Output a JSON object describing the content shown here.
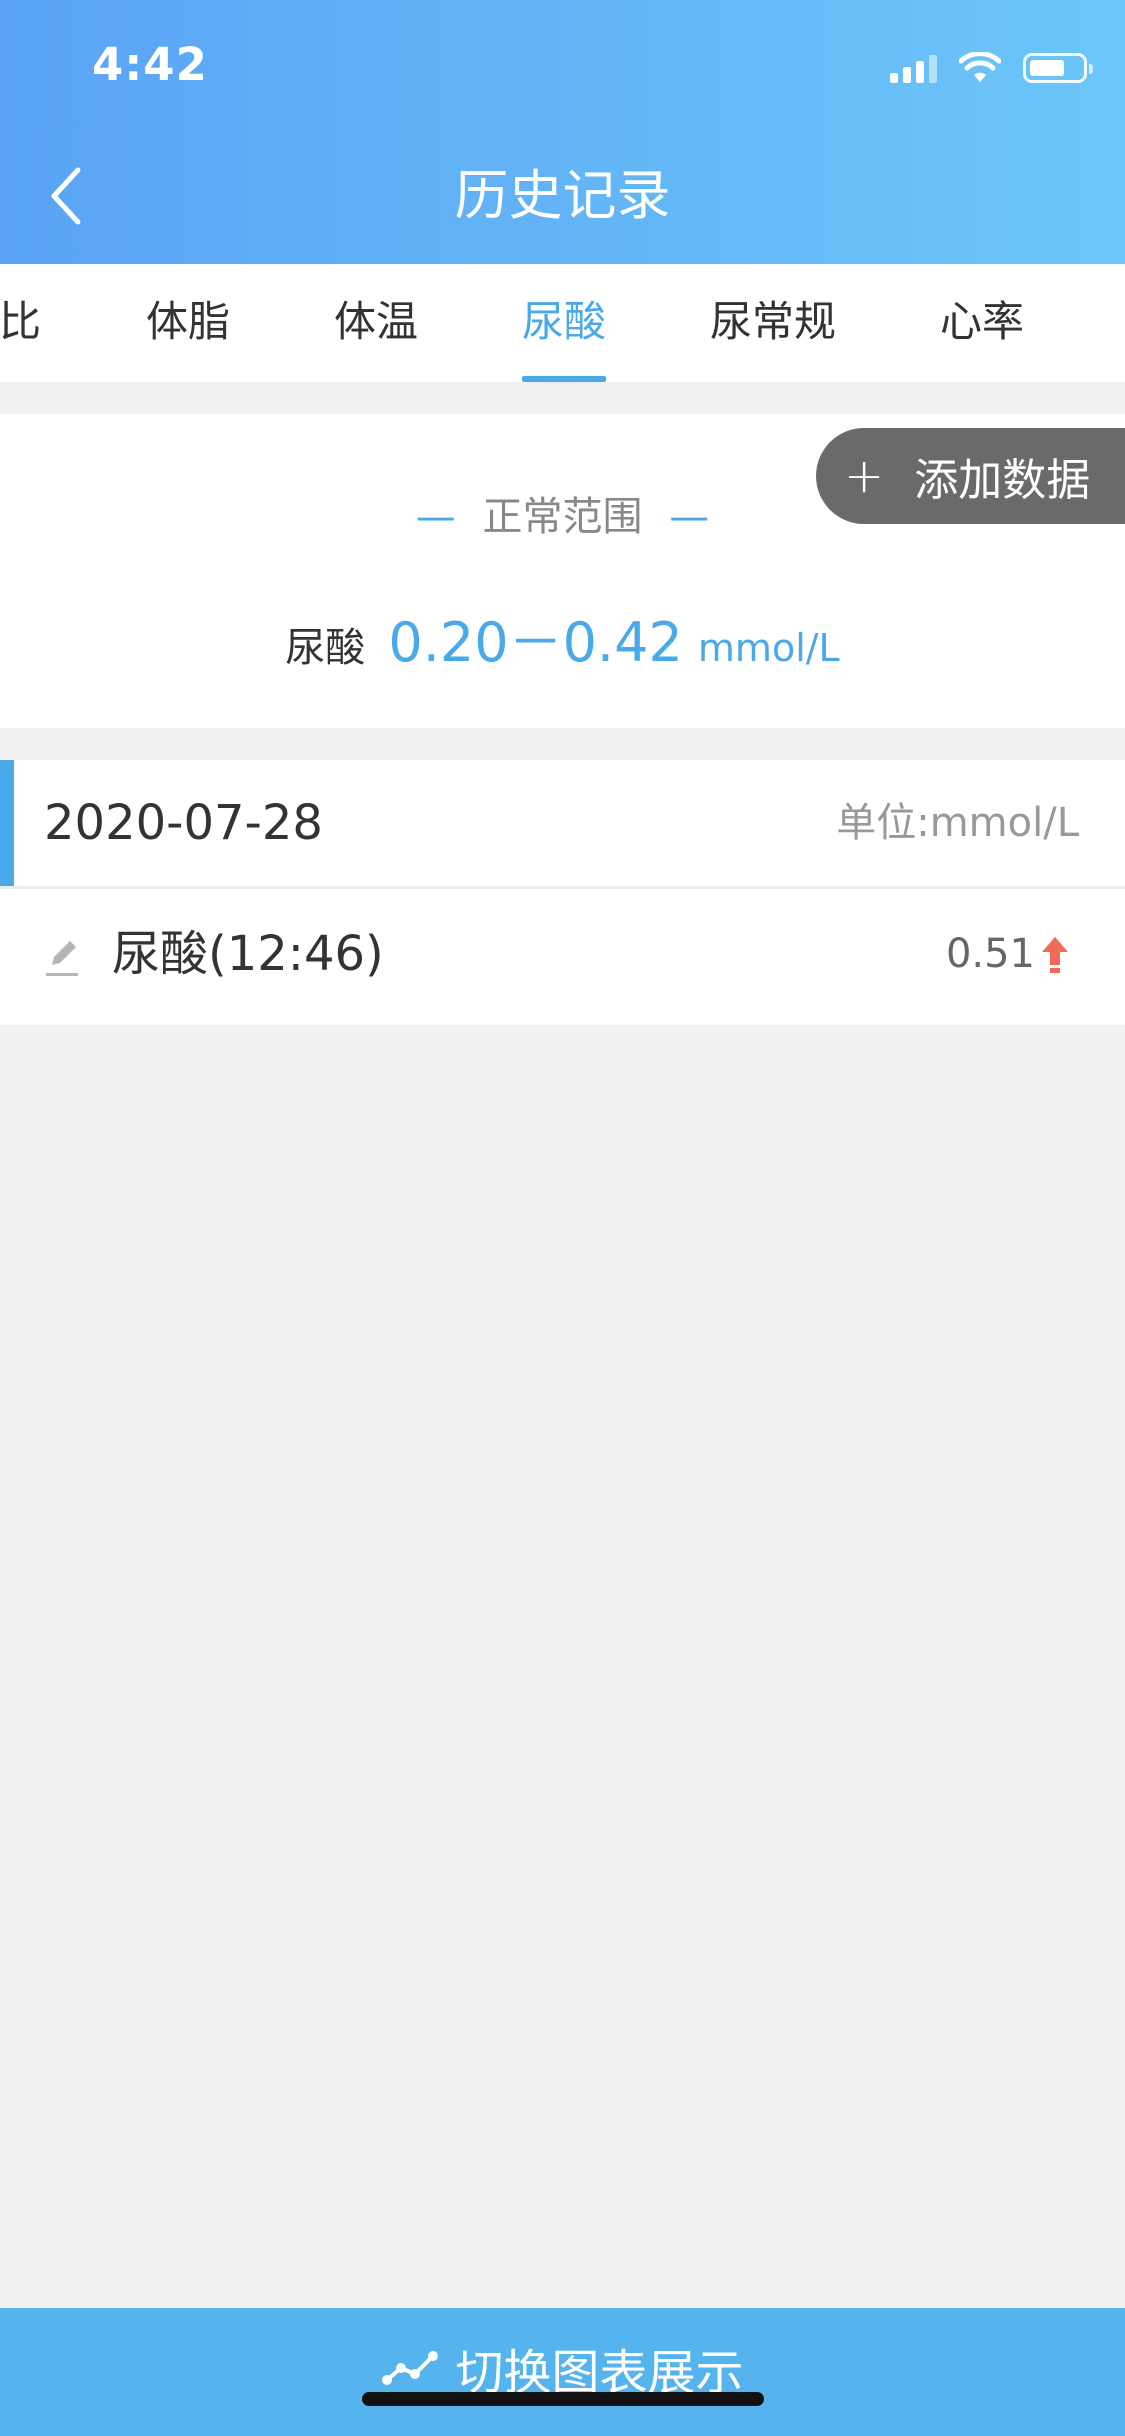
{
  "status_bar": {
    "time": "4:42"
  },
  "header": {
    "title": "历史记录",
    "back_icon": "chevron-left-icon"
  },
  "tabs": [
    {
      "label": "比",
      "active": false
    },
    {
      "label": "体脂",
      "active": false
    },
    {
      "label": "体温",
      "active": false
    },
    {
      "label": "尿酸",
      "active": true
    },
    {
      "label": "尿常规",
      "active": false
    },
    {
      "label": "心率",
      "active": false
    }
  ],
  "range": {
    "heading_dash": "—",
    "heading": "正常范围",
    "name": "尿酸",
    "value": "0.20－0.42",
    "unit": "mmol/L"
  },
  "add_button": {
    "icon": "plus-icon",
    "label": "添加数据"
  },
  "records_group": {
    "date": "2020-07-28",
    "unit_label": "单位:mmol/L",
    "records": [
      {
        "label": "尿酸(12:46)",
        "value": "0.51",
        "trend": "up",
        "trend_color": "#f06a5a"
      }
    ]
  },
  "bottom_bar": {
    "icon": "line-chart-icon",
    "label": "切换图表展示"
  },
  "colors": {
    "accent": "#4aa9e8",
    "header_gradient_start": "#5aa3f5",
    "header_gradient_end": "#6cc6f8",
    "bottom_bar": "#55b3ee",
    "alert_up": "#f06a5a"
  }
}
